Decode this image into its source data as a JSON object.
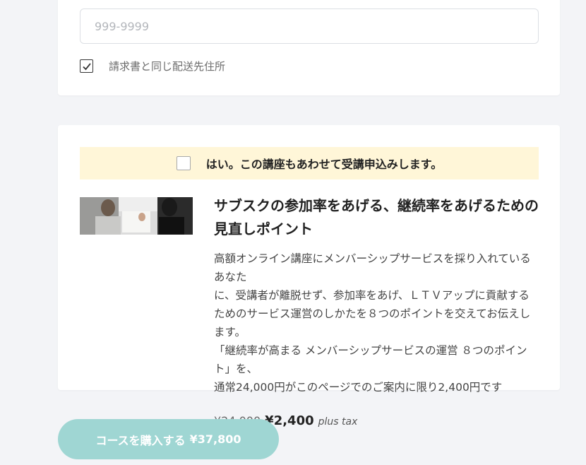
{
  "shipping": {
    "zip_placeholder": "999-9999",
    "zip_value": "",
    "same_as_billing_checked": true,
    "same_as_billing_label": "請求書と同じ配送先住所"
  },
  "upsell": {
    "checked": false,
    "checkbox_label": "はい。この講座もあわせて受講申込みします。",
    "title_line1": "サブスクの参加率をあげる、継続率をあげるための",
    "title_line2": "見直しポイント",
    "description_lines": [
      "高額オンライン講座にメンバーシップサービスを採り入れているあなた",
      "に、受講者が離脱せず、参加率をあげ、ＬＴＶアップに貢献する",
      "ためのサービス運営のしかたを８つのポイントを交えてお伝えします。",
      "「継続率が高まる メンバーシップサービスの運営 ８つのポイント」を、",
      "通常24,000円がこのページでのご案内に限り2,400円です"
    ],
    "price_original": "¥24,000",
    "price_sale": "¥2,400",
    "price_tax_note": "plus tax",
    "thumbnail_icon": "course-photo"
  },
  "checkout": {
    "buy_label": "コースを購入する",
    "buy_amount": "¥37,800"
  },
  "colors": {
    "page_bg": "#f3f4f7",
    "offer_bar_bg": "#fff6d8",
    "buy_button_bg": "#9fd6d3"
  }
}
